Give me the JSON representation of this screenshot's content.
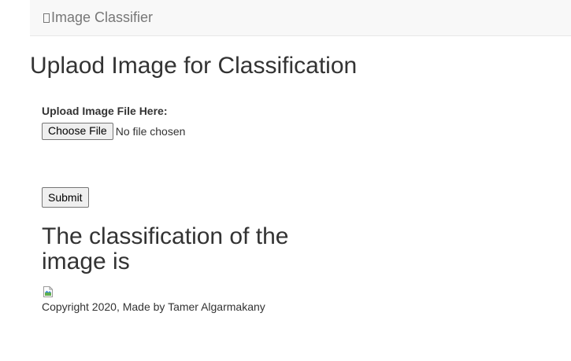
{
  "navbar": {
    "brand_glyph": "broken-glyph-icon",
    "brand": "Image Classifier"
  },
  "page_title": "Uplaod Image for Classification",
  "upload_form": {
    "label": "Upload Image File Here:",
    "choose_file_label": "Choose File",
    "file_status": "No file chosen",
    "submit_label": "Submit"
  },
  "result": {
    "heading": "The classification of the image is",
    "image_icon": "broken-image-icon"
  },
  "footer": {
    "copyright": "Copyright 2020, Made by Tamer Algarmakany"
  }
}
